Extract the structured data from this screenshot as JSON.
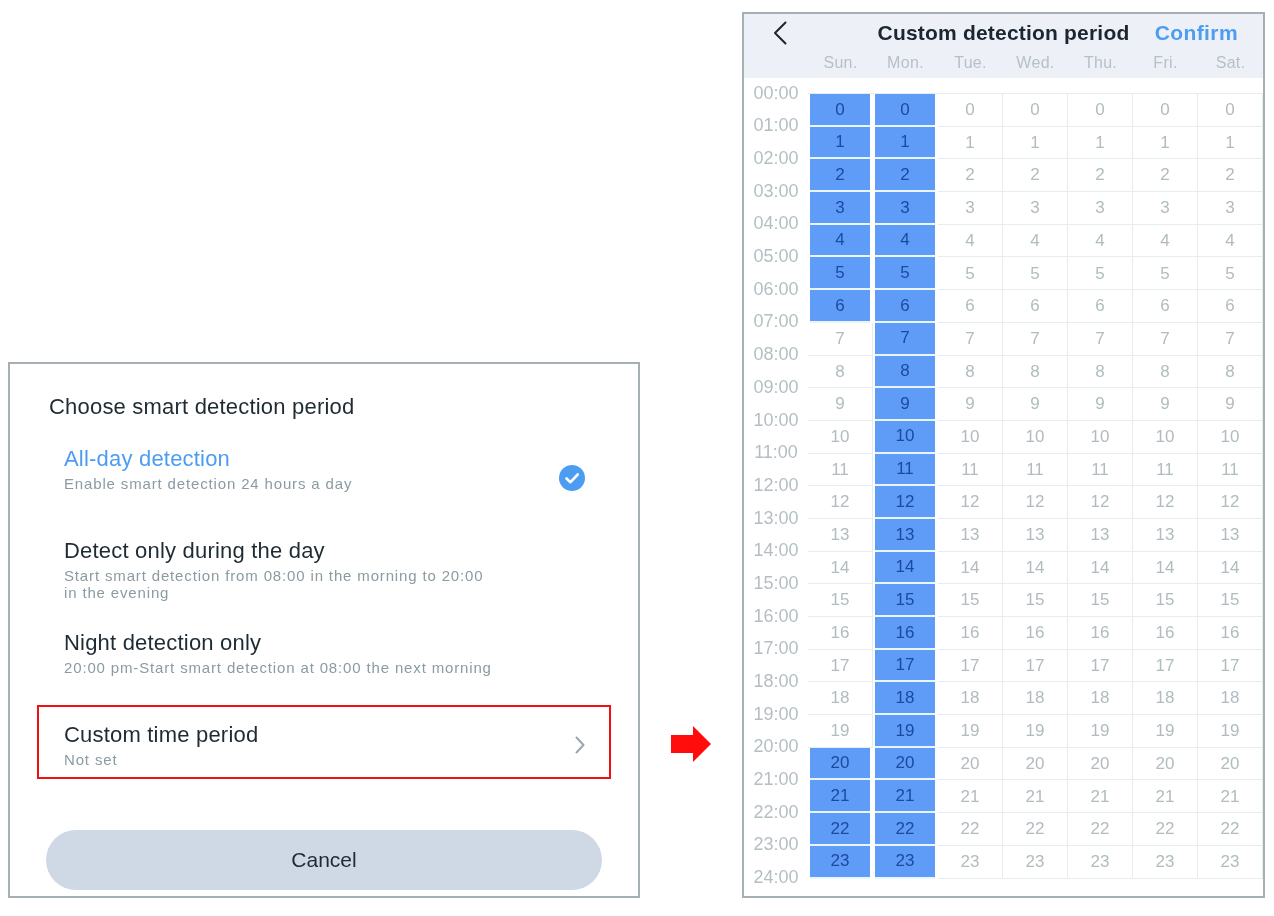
{
  "left_panel": {
    "title": "Choose smart detection period",
    "options": [
      {
        "kind": "check",
        "label": "All-day detection",
        "description": "Enable smart detection 24 hours a day",
        "selected": true,
        "highlighted": false
      },
      {
        "kind": "check",
        "label": "Detect only during the day",
        "description": "Start smart detection from 08:00 in the morning to 20:00 in the evening",
        "selected": false,
        "highlighted": false
      },
      {
        "kind": "check",
        "label": "Night detection only",
        "description": "20:00 pm-Start smart detection at 08:00 the next morning",
        "selected": false,
        "highlighted": false
      },
      {
        "kind": "submenu",
        "label": "Custom time period",
        "description": "Not set",
        "selected": false,
        "highlighted": true
      }
    ],
    "cancel_button": "Cancel"
  },
  "right_panel": {
    "title": "Custom detection period",
    "confirm_button": "Confirm",
    "day_headers": [
      "Sun.",
      "Mon.",
      "Tue.",
      "Wed.",
      "Thu.",
      "Fri.",
      "Sat."
    ],
    "time_labels": [
      "00:00",
      "01:00",
      "02:00",
      "03:00",
      "04:00",
      "05:00",
      "06:00",
      "07:00",
      "08:00",
      "09:00",
      "10:00",
      "11:00",
      "12:00",
      "13:00",
      "14:00",
      "15:00",
      "16:00",
      "17:00",
      "18:00",
      "19:00",
      "20:00",
      "21:00",
      "22:00",
      "23:00",
      "24:00"
    ],
    "rows": [
      {
        "cells": [
          {
            "text": "0",
            "selected": true
          },
          {
            "text": "0",
            "selected": true
          },
          {
            "text": "0",
            "selected": false
          },
          {
            "text": "0",
            "selected": false
          },
          {
            "text": "0",
            "selected": false
          },
          {
            "text": "0",
            "selected": false
          },
          {
            "text": "0",
            "selected": false
          }
        ]
      },
      {
        "cells": [
          {
            "text": "1",
            "selected": true
          },
          {
            "text": "1",
            "selected": true
          },
          {
            "text": "1",
            "selected": false
          },
          {
            "text": "1",
            "selected": false
          },
          {
            "text": "1",
            "selected": false
          },
          {
            "text": "1",
            "selected": false
          },
          {
            "text": "1",
            "selected": false
          }
        ]
      },
      {
        "cells": [
          {
            "text": "2",
            "selected": true
          },
          {
            "text": "2",
            "selected": true
          },
          {
            "text": "2",
            "selected": false
          },
          {
            "text": "2",
            "selected": false
          },
          {
            "text": "2",
            "selected": false
          },
          {
            "text": "2",
            "selected": false
          },
          {
            "text": "2",
            "selected": false
          }
        ]
      },
      {
        "cells": [
          {
            "text": "3",
            "selected": true
          },
          {
            "text": "3",
            "selected": true
          },
          {
            "text": "3",
            "selected": false
          },
          {
            "text": "3",
            "selected": false
          },
          {
            "text": "3",
            "selected": false
          },
          {
            "text": "3",
            "selected": false
          },
          {
            "text": "3",
            "selected": false
          }
        ]
      },
      {
        "cells": [
          {
            "text": "4",
            "selected": true
          },
          {
            "text": "4",
            "selected": true
          },
          {
            "text": "4",
            "selected": false
          },
          {
            "text": "4",
            "selected": false
          },
          {
            "text": "4",
            "selected": false
          },
          {
            "text": "4",
            "selected": false
          },
          {
            "text": "4",
            "selected": false
          }
        ]
      },
      {
        "cells": [
          {
            "text": "5",
            "selected": true
          },
          {
            "text": "5",
            "selected": true
          },
          {
            "text": "5",
            "selected": false
          },
          {
            "text": "5",
            "selected": false
          },
          {
            "text": "5",
            "selected": false
          },
          {
            "text": "5",
            "selected": false
          },
          {
            "text": "5",
            "selected": false
          }
        ]
      },
      {
        "cells": [
          {
            "text": "6",
            "selected": true
          },
          {
            "text": "6",
            "selected": true
          },
          {
            "text": "6",
            "selected": false
          },
          {
            "text": "6",
            "selected": false
          },
          {
            "text": "6",
            "selected": false
          },
          {
            "text": "6",
            "selected": false
          },
          {
            "text": "6",
            "selected": false
          }
        ]
      },
      {
        "cells": [
          {
            "text": "7",
            "selected": false
          },
          {
            "text": "7",
            "selected": true
          },
          {
            "text": "7",
            "selected": false
          },
          {
            "text": "7",
            "selected": false
          },
          {
            "text": "7",
            "selected": false
          },
          {
            "text": "7",
            "selected": false
          },
          {
            "text": "7",
            "selected": false
          }
        ]
      },
      {
        "cells": [
          {
            "text": "8",
            "selected": false
          },
          {
            "text": "8",
            "selected": true
          },
          {
            "text": "8",
            "selected": false
          },
          {
            "text": "8",
            "selected": false
          },
          {
            "text": "8",
            "selected": false
          },
          {
            "text": "8",
            "selected": false
          },
          {
            "text": "8",
            "selected": false
          }
        ]
      },
      {
        "cells": [
          {
            "text": "9",
            "selected": false
          },
          {
            "text": "9",
            "selected": true
          },
          {
            "text": "9",
            "selected": false
          },
          {
            "text": "9",
            "selected": false
          },
          {
            "text": "9",
            "selected": false
          },
          {
            "text": "9",
            "selected": false
          },
          {
            "text": "9",
            "selected": false
          }
        ]
      },
      {
        "cells": [
          {
            "text": "10",
            "selected": false
          },
          {
            "text": "10",
            "selected": true
          },
          {
            "text": "10",
            "selected": false
          },
          {
            "text": "10",
            "selected": false
          },
          {
            "text": "10",
            "selected": false
          },
          {
            "text": "10",
            "selected": false
          },
          {
            "text": "10",
            "selected": false
          }
        ]
      },
      {
        "cells": [
          {
            "text": "11",
            "selected": false
          },
          {
            "text": "11",
            "selected": true
          },
          {
            "text": "11",
            "selected": false
          },
          {
            "text": "11",
            "selected": false
          },
          {
            "text": "11",
            "selected": false
          },
          {
            "text": "11",
            "selected": false
          },
          {
            "text": "11",
            "selected": false
          }
        ]
      },
      {
        "cells": [
          {
            "text": "12",
            "selected": false
          },
          {
            "text": "12",
            "selected": true
          },
          {
            "text": "12",
            "selected": false
          },
          {
            "text": "12",
            "selected": false
          },
          {
            "text": "12",
            "selected": false
          },
          {
            "text": "12",
            "selected": false
          },
          {
            "text": "12",
            "selected": false
          }
        ]
      },
      {
        "cells": [
          {
            "text": "13",
            "selected": false
          },
          {
            "text": "13",
            "selected": true
          },
          {
            "text": "13",
            "selected": false
          },
          {
            "text": "13",
            "selected": false
          },
          {
            "text": "13",
            "selected": false
          },
          {
            "text": "13",
            "selected": false
          },
          {
            "text": "13",
            "selected": false
          }
        ]
      },
      {
        "cells": [
          {
            "text": "14",
            "selected": false
          },
          {
            "text": "14",
            "selected": true
          },
          {
            "text": "14",
            "selected": false
          },
          {
            "text": "14",
            "selected": false
          },
          {
            "text": "14",
            "selected": false
          },
          {
            "text": "14",
            "selected": false
          },
          {
            "text": "14",
            "selected": false
          }
        ]
      },
      {
        "cells": [
          {
            "text": "15",
            "selected": false
          },
          {
            "text": "15",
            "selected": true
          },
          {
            "text": "15",
            "selected": false
          },
          {
            "text": "15",
            "selected": false
          },
          {
            "text": "15",
            "selected": false
          },
          {
            "text": "15",
            "selected": false
          },
          {
            "text": "15",
            "selected": false
          }
        ]
      },
      {
        "cells": [
          {
            "text": "16",
            "selected": false
          },
          {
            "text": "16",
            "selected": true
          },
          {
            "text": "16",
            "selected": false
          },
          {
            "text": "16",
            "selected": false
          },
          {
            "text": "16",
            "selected": false
          },
          {
            "text": "16",
            "selected": false
          },
          {
            "text": "16",
            "selected": false
          }
        ]
      },
      {
        "cells": [
          {
            "text": "17",
            "selected": false
          },
          {
            "text": "17",
            "selected": true
          },
          {
            "text": "17",
            "selected": false
          },
          {
            "text": "17",
            "selected": false
          },
          {
            "text": "17",
            "selected": false
          },
          {
            "text": "17",
            "selected": false
          },
          {
            "text": "17",
            "selected": false
          }
        ]
      },
      {
        "cells": [
          {
            "text": "18",
            "selected": false
          },
          {
            "text": "18",
            "selected": true
          },
          {
            "text": "18",
            "selected": false
          },
          {
            "text": "18",
            "selected": false
          },
          {
            "text": "18",
            "selected": false
          },
          {
            "text": "18",
            "selected": false
          },
          {
            "text": "18",
            "selected": false
          }
        ]
      },
      {
        "cells": [
          {
            "text": "19",
            "selected": false
          },
          {
            "text": "19",
            "selected": true
          },
          {
            "text": "19",
            "selected": false
          },
          {
            "text": "19",
            "selected": false
          },
          {
            "text": "19",
            "selected": false
          },
          {
            "text": "19",
            "selected": false
          },
          {
            "text": "19",
            "selected": false
          }
        ]
      },
      {
        "cells": [
          {
            "text": "20",
            "selected": true
          },
          {
            "text": "20",
            "selected": true
          },
          {
            "text": "20",
            "selected": false
          },
          {
            "text": "20",
            "selected": false
          },
          {
            "text": "20",
            "selected": false
          },
          {
            "text": "20",
            "selected": false
          },
          {
            "text": "20",
            "selected": false
          }
        ]
      },
      {
        "cells": [
          {
            "text": "21",
            "selected": true
          },
          {
            "text": "21",
            "selected": true
          },
          {
            "text": "21",
            "selected": false
          },
          {
            "text": "21",
            "selected": false
          },
          {
            "text": "21",
            "selected": false
          },
          {
            "text": "21",
            "selected": false
          },
          {
            "text": "21",
            "selected": false
          }
        ]
      },
      {
        "cells": [
          {
            "text": "22",
            "selected": true
          },
          {
            "text": "22",
            "selected": true
          },
          {
            "text": "22",
            "selected": false
          },
          {
            "text": "22",
            "selected": false
          },
          {
            "text": "22",
            "selected": false
          },
          {
            "text": "22",
            "selected": false
          },
          {
            "text": "22",
            "selected": false
          }
        ]
      },
      {
        "cells": [
          {
            "text": "23",
            "selected": true
          },
          {
            "text": "23",
            "selected": true
          },
          {
            "text": "23",
            "selected": false
          },
          {
            "text": "23",
            "selected": false
          },
          {
            "text": "23",
            "selected": false
          },
          {
            "text": "23",
            "selected": false
          },
          {
            "text": "23",
            "selected": false
          }
        ]
      }
    ]
  }
}
